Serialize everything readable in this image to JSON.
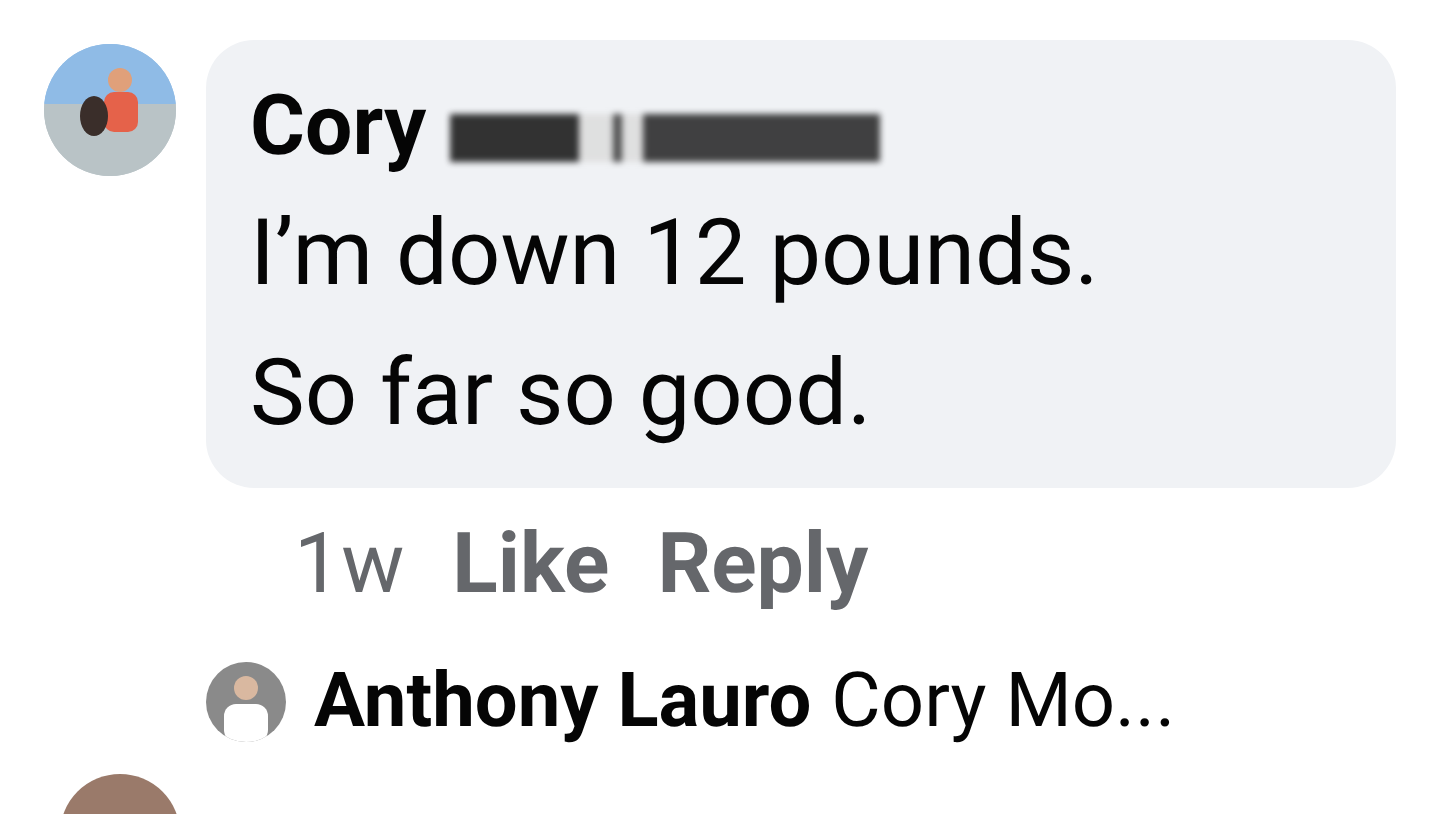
{
  "comment": {
    "author": "Cory",
    "author_redacted": true,
    "text_lines": [
      "I’m down 12 pounds.",
      "So far so good."
    ],
    "time": "1w",
    "actions": [
      "Like",
      "Reply"
    ]
  },
  "reply_preview": {
    "author": "Anthony Lauro",
    "text": "Cory Mo..."
  }
}
